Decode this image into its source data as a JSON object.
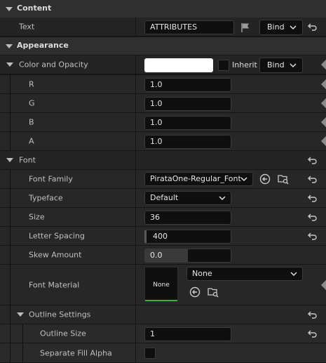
{
  "sections": {
    "content": "Content",
    "appearance": "Appearance"
  },
  "text_prop": {
    "label": "Text",
    "value": "ATTRIBUTES",
    "bind": "Bind"
  },
  "color_opacity": {
    "label": "Color and Opacity",
    "swatch_color": "#ffffff",
    "inherit_label": "Inherit",
    "bind": "Bind",
    "channels": [
      {
        "label": "R",
        "value": "1.0"
      },
      {
        "label": "G",
        "value": "1.0"
      },
      {
        "label": "B",
        "value": "1.0"
      },
      {
        "label": "A",
        "value": "1.0"
      }
    ]
  },
  "font": {
    "label": "Font",
    "family": {
      "label": "Font Family",
      "value": "PirataOne-Regular_Font"
    },
    "typeface": {
      "label": "Typeface",
      "value": "Default"
    },
    "size": {
      "label": "Size",
      "value": "36"
    },
    "letter_spacing": {
      "label": "Letter Spacing",
      "value": "400"
    },
    "skew": {
      "label": "Skew Amount",
      "value": "0.0"
    },
    "material": {
      "label": "Font Material",
      "thumb": "None",
      "value": "None"
    },
    "outline": {
      "label": "Outline Settings",
      "size": {
        "label": "Outline Size",
        "value": "1"
      },
      "fill_alpha": {
        "label": "Separate Fill Alpha",
        "checked": false
      }
    }
  },
  "colors": {
    "accent_green": "#3fae3f"
  }
}
